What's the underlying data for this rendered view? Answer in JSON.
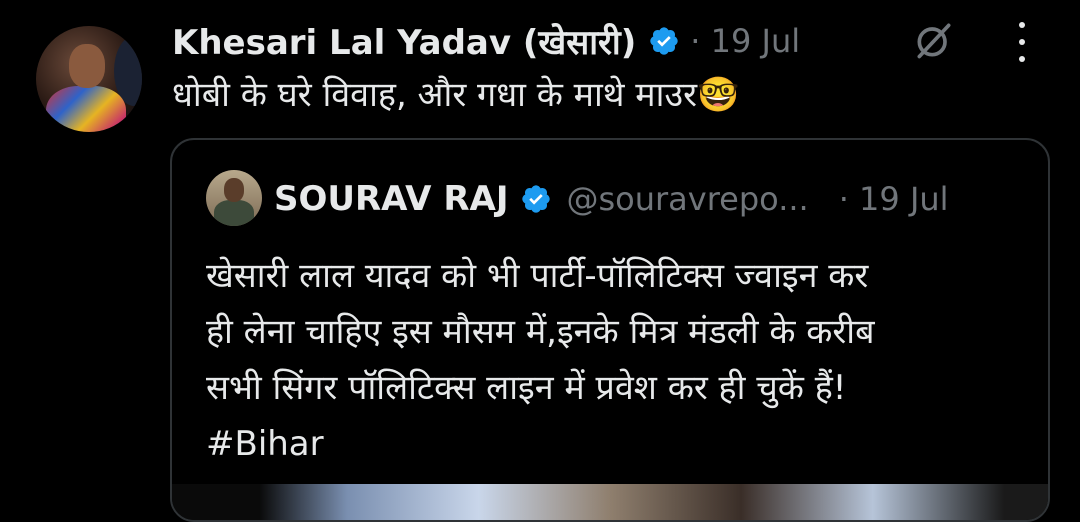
{
  "tweet": {
    "author_name": "Khesari Lal Yadav (खेसारी)",
    "date": "· 19 Jul",
    "text": "धोबी के घरे विवाह, और गधा के माथे माउर🤓"
  },
  "quote": {
    "author_name": "SOURAV RAJ",
    "handle": "@souravrepo...",
    "date": "· 19 Jul",
    "text_lines": [
      "खेसारी लाल यादव को भी पार्टी-पॉलिटिक्स ज्वाइन कर",
      "ही लेना चाहिए इस मौसम में,इनके मित्र मंडली के करीब",
      "सभी सिंगर पॉलिटिक्स लाइन में प्रवेश कर ही चुकें हैं!",
      "#Bihar"
    ]
  },
  "icons": {
    "verified": "verified-badge-icon",
    "grok": "grok-icon",
    "more": "more-options-icon"
  },
  "colors": {
    "background": "#000000",
    "text": "#e7e9ea",
    "muted": "#71767b",
    "verified_blue": "#1d9bf0",
    "border": "#2f3336"
  }
}
